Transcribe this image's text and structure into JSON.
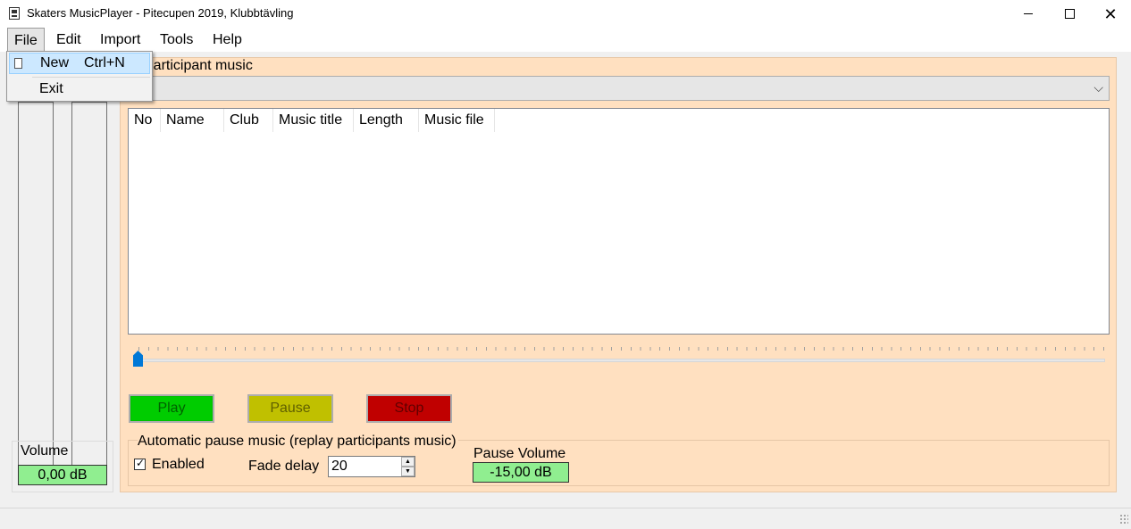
{
  "window": {
    "title": "Skaters MusicPlayer - Pitecupen 2019, Klubbtävling",
    "controls": [
      "minimize",
      "maximize",
      "close"
    ]
  },
  "menu": {
    "file": "File",
    "edit": "Edit",
    "import": "Import",
    "tools": "Tools",
    "help": "Help"
  },
  "file_menu": {
    "new_label": "New",
    "new_shortcut": "Ctrl+N",
    "exit_label": "Exit"
  },
  "main": {
    "group_title": "Participant music",
    "combo_value": "",
    "columns": [
      "No",
      "Name",
      "Club",
      "Music title",
      "Length",
      "Music file"
    ],
    "rows": [],
    "slider_position": 0
  },
  "buttons": {
    "play": "Play",
    "pause": "Pause",
    "stop": "Stop"
  },
  "colors": {
    "play": "#00cc00",
    "pause": "#c0c000",
    "stop": "#c00000",
    "panel": "#ffe0c0",
    "db_display": "#90ee90"
  },
  "volume": {
    "label": "Volume",
    "value": "0,00 dB"
  },
  "auto_pause": {
    "title": "Automatic pause music (replay participants music)",
    "enabled_label": "Enabled",
    "enabled": true,
    "fade_label": "Fade delay",
    "fade_value": "20",
    "pause_volume_label": "Pause Volume",
    "pause_volume_value": "-15,00 dB"
  }
}
